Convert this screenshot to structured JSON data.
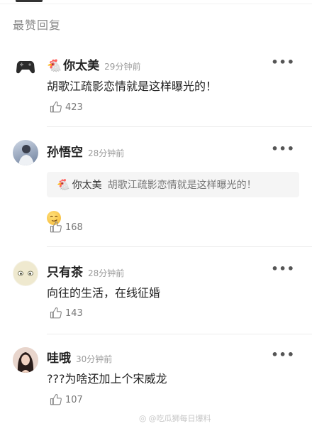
{
  "section_title": "最赞回复",
  "more_label": "•••",
  "comments": [
    {
      "badge": "🐔",
      "username": "你太美",
      "time": "29分钟前",
      "text": "胡歌江疏影恋情就是这样曝光的！",
      "likes": "423",
      "avatar_icon": "gamepad-avatar"
    },
    {
      "username": "孙悟空",
      "time": "28分钟前",
      "quote": {
        "badge": "🐔",
        "name": "你太美",
        "text": "胡歌江疏影恋情就是这样曝光的！"
      },
      "emoji": "smirk-emoji",
      "likes": "168",
      "avatar_icon": "portrait-avatar"
    },
    {
      "username": "只有茶",
      "time": "28分钟前",
      "text": "向往的生活，在线征婚",
      "likes": "143",
      "avatar_icon": "cartoon-face-avatar"
    },
    {
      "username": "哇哦",
      "time": "30分钟前",
      "text": "???为啥还加上个宋威龙",
      "likes": "107",
      "avatar_icon": "woman-portrait-avatar"
    }
  ],
  "watermark": "@吃瓜狮每日爆料"
}
